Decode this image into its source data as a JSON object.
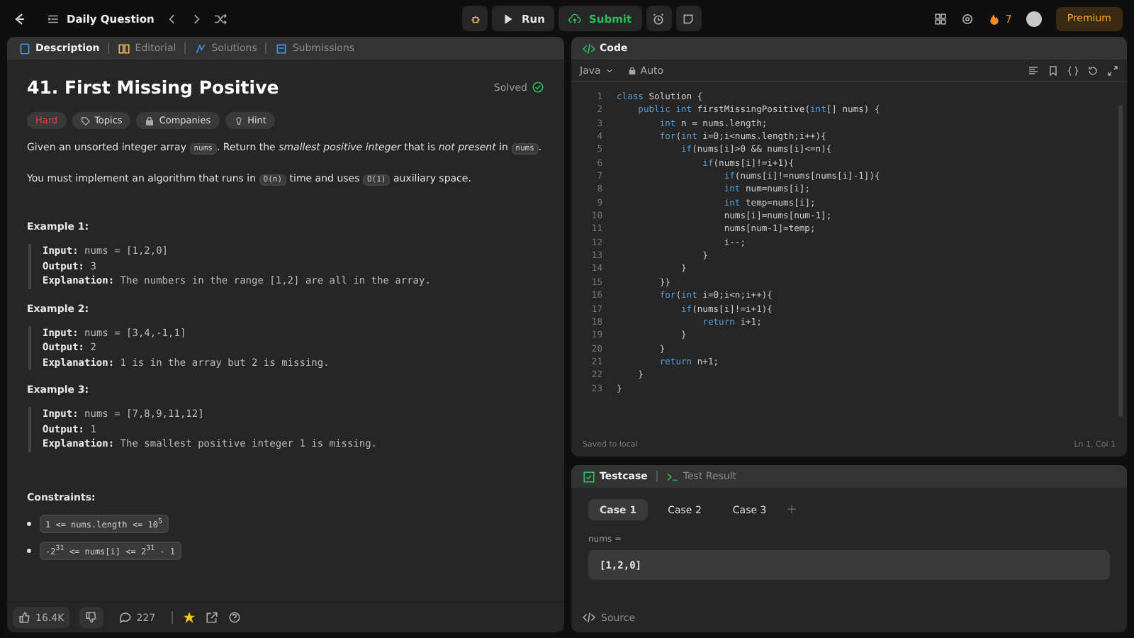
{
  "top_bar": {
    "title": "Daily Question",
    "run": "Run",
    "submit": "Submit",
    "streak": "7",
    "premium": "Premium"
  },
  "description_panel": {
    "tabs": [
      {
        "label": "Description",
        "selected": true
      },
      {
        "label": "Editorial",
        "selected": false
      },
      {
        "label": "Solutions",
        "selected": false
      },
      {
        "label": "Submissions",
        "selected": false
      }
    ],
    "title": "41. First Missing Positive",
    "status": "Solved",
    "tags": [
      {
        "label": "Hard",
        "kind": "difficulty"
      },
      {
        "label": "Topics",
        "kind": "topics"
      },
      {
        "label": "Companies",
        "kind": "companies"
      },
      {
        "label": "Hint",
        "kind": "hint"
      }
    ],
    "paragraphs": [
      [
        {
          "kind": "text",
          "text": "Given an unsorted integer array "
        },
        {
          "kind": "code",
          "text": "nums"
        },
        {
          "kind": "text",
          "text": ". Return the *smallest positive integer* that is *not present* in "
        },
        {
          "kind": "code",
          "text": "nums"
        },
        {
          "kind": "text",
          "text": "."
        }
      ],
      [
        {
          "kind": "text",
          "text": "You must implement an algorithm that runs in "
        },
        {
          "kind": "code",
          "text": "O(n)"
        },
        {
          "kind": "text",
          "text": " time and uses "
        },
        {
          "kind": "code",
          "text": "O(1)"
        },
        {
          "kind": "text",
          "text": " auxiliary space."
        }
      ]
    ],
    "examples": [
      {
        "heading": "Example 1:",
        "lines": [
          {
            "label": "Input:",
            "value": "nums = [1,2,0]"
          },
          {
            "label": "Output:",
            "value": "3"
          },
          {
            "label": "Explanation:",
            "value": "The numbers in the range [1,2] are all in the array."
          }
        ]
      },
      {
        "heading": "Example 2:",
        "lines": [
          {
            "label": "Input:",
            "value": "nums = [3,4,-1,1]"
          },
          {
            "label": "Output:",
            "value": "2"
          },
          {
            "label": "Explanation:",
            "value": "1 is in the array but 2 is missing."
          }
        ]
      },
      {
        "heading": "Example 3:",
        "lines": [
          {
            "label": "Input:",
            "value": "nums = [7,8,9,11,12]"
          },
          {
            "label": "Output:",
            "value": "1"
          },
          {
            "label": "Explanation:",
            "value": "The smallest positive integer 1 is missing."
          }
        ]
      }
    ],
    "constraints_heading": "Constraints:",
    "constraints": [
      "1 <= nums.length <= 10$^{5}$",
      "-2$^{31}$ <= nums[i] <= 2$^{31}$ - 1"
    ],
    "footer": {
      "likes": "16.4K",
      "comments": "227"
    }
  },
  "code_panel": {
    "title": "Code",
    "language": "Java",
    "mode": "Auto",
    "lines": [
      {
        "number": "1",
        "code": "class Solution {"
      },
      {
        "number": "2",
        "code": "    public int firstMissingPositive(int[] nums) {"
      },
      {
        "number": "3",
        "code": "        int n = nums.length;"
      },
      {
        "number": "4",
        "code": "        for(int i=0;i<nums.length;i++){"
      },
      {
        "number": "5",
        "code": "            if(nums[i]>0 && nums[i]<=n){"
      },
      {
        "number": "6",
        "code": "                if(nums[i]!=i+1){"
      },
      {
        "number": "7",
        "code": "                    if(nums[i]!=nums[nums[i]-1]){"
      },
      {
        "number": "8",
        "code": "                    int num=nums[i];"
      },
      {
        "number": "9",
        "code": "                    int temp=nums[i];"
      },
      {
        "number": "10",
        "code": "                    nums[i]=nums[num-1];"
      },
      {
        "number": "11",
        "code": "                    nums[num-1]=temp;"
      },
      {
        "number": "12",
        "code": "                    i--;"
      },
      {
        "number": "13",
        "code": "                }"
      },
      {
        "number": "14",
        "code": "            }"
      },
      {
        "number": "15",
        "code": "        }}"
      },
      {
        "number": "16",
        "code": "        for(int i=0;i<n;i++){"
      },
      {
        "number": "17",
        "code": "            if(nums[i]!=i+1){"
      },
      {
        "number": "18",
        "code": "                return i+1;"
      },
      {
        "number": "19",
        "code": "            }"
      },
      {
        "number": "20",
        "code": "        }"
      },
      {
        "number": "21",
        "code": "        return n+1;"
      },
      {
        "number": "22",
        "code": "    }"
      },
      {
        "number": "23",
        "code": "}"
      }
    ],
    "saved": "Saved to local",
    "cursor": "Ln 1, Col 1"
  },
  "testcase_panel": {
    "tabs": [
      {
        "label": "Testcase",
        "selected": true
      },
      {
        "label": "Test Result",
        "selected": false
      }
    ],
    "cases": [
      {
        "label": "Case 1",
        "selected": true
      },
      {
        "label": "Case 2",
        "selected": false
      },
      {
        "label": "Case 3",
        "selected": false
      }
    ],
    "add": "+",
    "field_label": "nums =",
    "field_value": "[1,2,0]",
    "source": "Source"
  }
}
